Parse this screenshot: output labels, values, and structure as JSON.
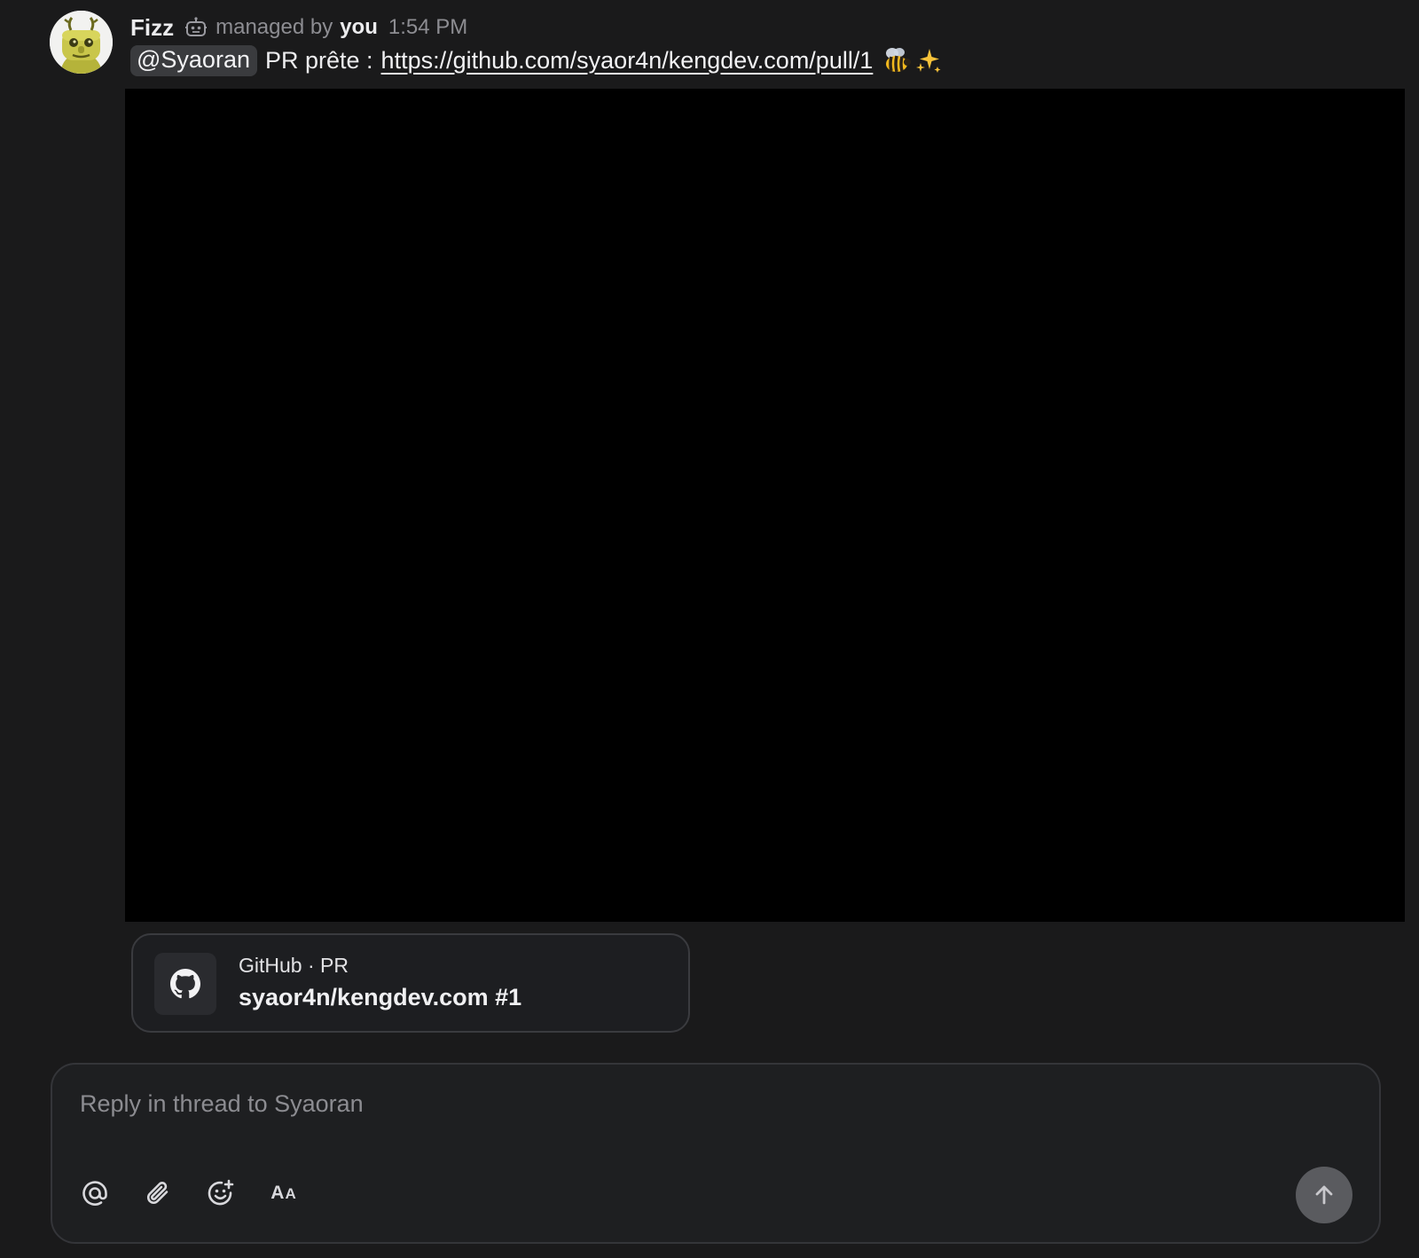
{
  "message": {
    "sender": "Fizz",
    "managed_label": "managed by",
    "manager": "you",
    "time": "1:54 PM",
    "avatar_icon": "robot-avatar-icon",
    "bot_badge_icon": "bot-icon",
    "mention": "@Syaoran",
    "text": "PR prête :",
    "link": "https://github.com/syaor4n/kengdev.com/pull/1",
    "emojis": [
      "bee-emoji",
      "sparkles-emoji"
    ]
  },
  "link_card": {
    "source": "GitHub · PR",
    "title": "syaor4n/kengdev.com #1",
    "icon": "github-icon"
  },
  "composer": {
    "placeholder": "Reply in thread to Syaoran",
    "tools": [
      "at-mention-icon",
      "paperclip-icon",
      "emoji-add-icon",
      "text-format-icon"
    ],
    "format_label": "AA",
    "send_icon": "arrow-up-icon"
  },
  "colors": {
    "background": "#1a1a1b",
    "media": "#000000",
    "send_button": "#5a5b5f"
  }
}
